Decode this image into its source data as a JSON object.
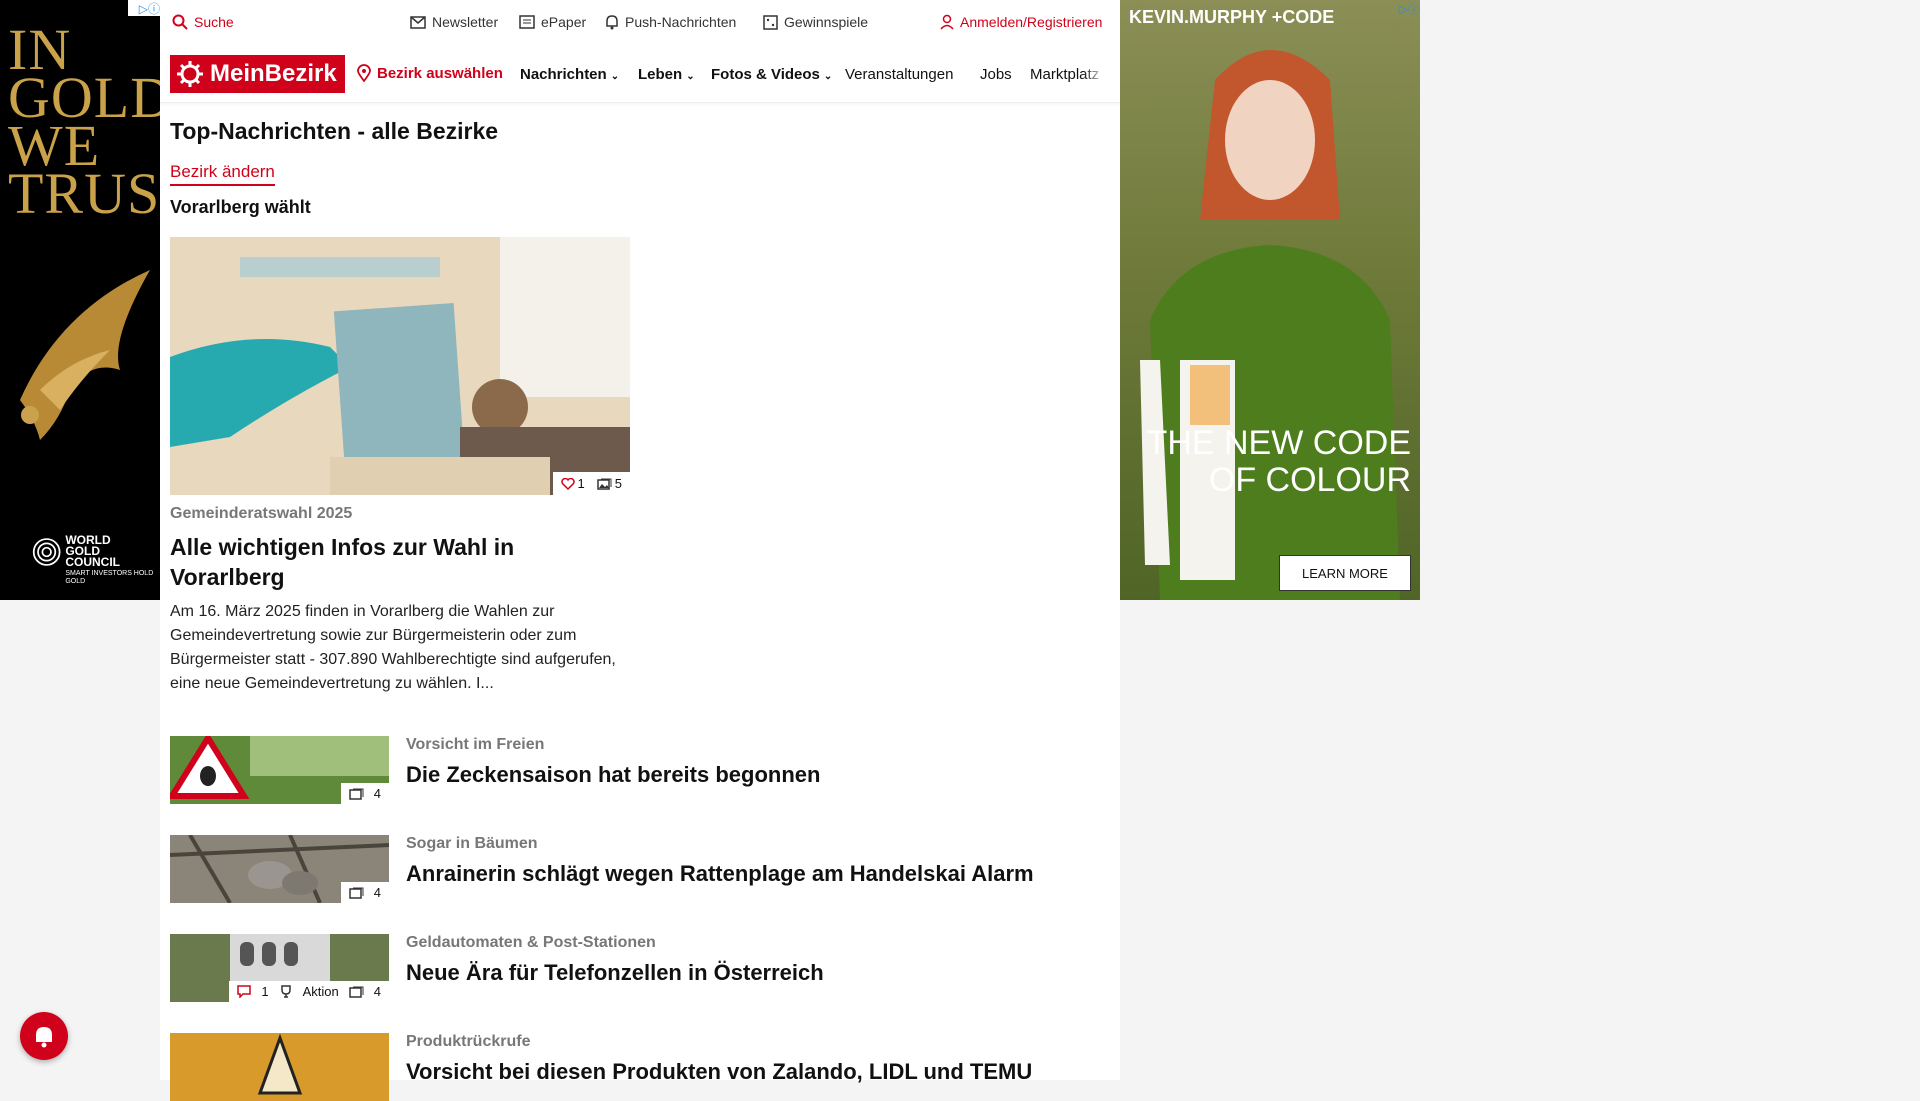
{
  "util_nav": {
    "search": "Suche",
    "newsletter": "Newsletter",
    "epaper": "ePaper",
    "push": "Push-Nachrichten",
    "contests": "Gewinnspiele",
    "login": "Anmelden/Registrieren"
  },
  "header": {
    "logo": "MeinBezirk",
    "select_district": "Bezirk auswählen",
    "nav": [
      "Nachrichten",
      "Leben",
      "Fotos & Videos",
      "Veranstaltungen",
      "Jobs",
      "Marktplatz"
    ]
  },
  "page": {
    "title": "Top-Nachrichten - alle Bezirke",
    "change_district": "Bezirk ändern",
    "section": "Vorarlberg wählt"
  },
  "hero": {
    "likes": "1",
    "images": "5",
    "kicker": "Gemeinderatswahl 2025",
    "title": "Alle wichtigen Infos zur Wahl in Vorarlberg",
    "teaser": "Am 16. März 2025 finden in Vorarlberg die Wahlen zur Gemeindevertretung sowie zur Bürgermeisterin oder zum Bürgermeister statt - 307.890 Wahlberechtigte sind aufgerufen, eine neue Gemeindevertretung zu wählen. I..."
  },
  "articles": [
    {
      "kicker": "Vorsicht im Freien",
      "title": "Die Zeckensaison hat bereits begonnen",
      "images": "4"
    },
    {
      "kicker": "Sogar in Bäumen",
      "title": "Anrainerin schlägt wegen Rattenplage am Handelskai Alarm",
      "images": "4"
    },
    {
      "kicker": "Geldautomaten & Post-Stationen",
      "title": "Neue Ära für Telefonzellen in Österreich",
      "comments": "1",
      "aktion": "Aktion",
      "images": "4"
    },
    {
      "kicker": "Produktrückrufe",
      "title": "Vorsicht bei diesen Produkten von Zalando, LIDL und TEMU"
    }
  ],
  "ad_left": {
    "headline": "IN GOLD WE TRUST",
    "brand_line1": "WORLD",
    "brand_line2": "GOLD",
    "brand_line3": "COUNCIL",
    "tagline": "SMART INVESTORS HOLD GOLD"
  },
  "ad_right": {
    "brand": "KEVIN.MURPHY +CODE",
    "headline": "THE NEW CODE OF COLOUR",
    "cta": "LEARN MORE"
  },
  "colors": {
    "accent": "#d0021b"
  }
}
